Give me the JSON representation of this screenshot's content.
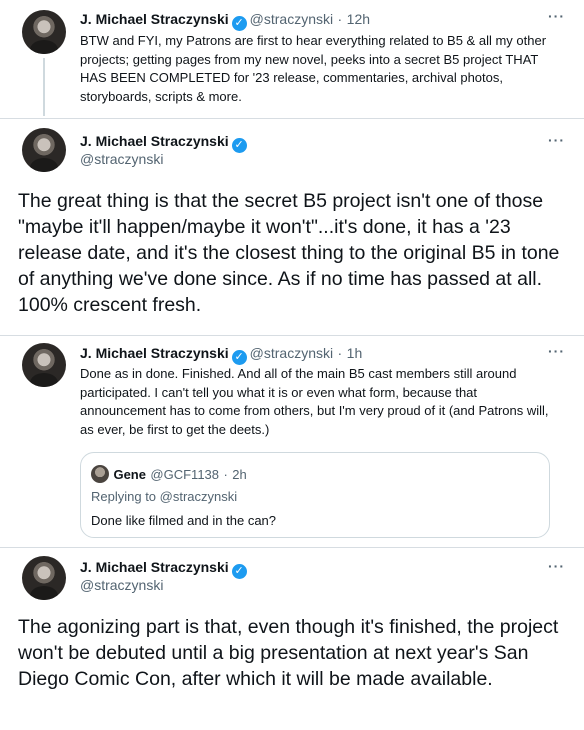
{
  "tweets": [
    {
      "name": "J. Michael Straczynski",
      "handle": "@straczynski",
      "time": "12h",
      "text": "BTW and FYI, my Patrons are first to hear everything related to B5 & all my other projects; getting pages from my new novel, peeks into a secret B5 project THAT HAS BEEN COMPLETED for '23 release, commentaries, archival photos, storyboards, scripts & more."
    },
    {
      "name": "J. Michael Straczynski",
      "handle": "@straczynski",
      "text": "The great thing is that the secret B5 project isn't one of those \"maybe it'll happen/maybe it won't\"...it's done, it has a '23 release date, and it's the closest thing to the original B5 in tone of anything we've done since. As if no time has passed at all. 100% crescent fresh."
    },
    {
      "name": "J. Michael Straczynski",
      "handle": "@straczynski",
      "time": "1h",
      "text": "Done as in done. Finished. And all of the main B5 cast members still around participated. I can't tell you what it is or even what form, because that announcement has to come from others, but I'm very proud of it (and Patrons will, as ever, be first to get the deets.)"
    },
    {
      "name": "J. Michael Straczynski",
      "handle": "@straczynski",
      "text": "The agonizing part is that, even though it's finished, the project won't be debuted until a big presentation at next year's San Diego Comic Con, after which it will be made available."
    }
  ],
  "quoted": {
    "name": "Gene",
    "handle": "@GCF1138",
    "time": "2h",
    "replying": "Replying to @straczynski",
    "text": "Done like filmed and in the can?"
  },
  "symbols": {
    "dot": "·",
    "more": "···",
    "check": "✓"
  }
}
